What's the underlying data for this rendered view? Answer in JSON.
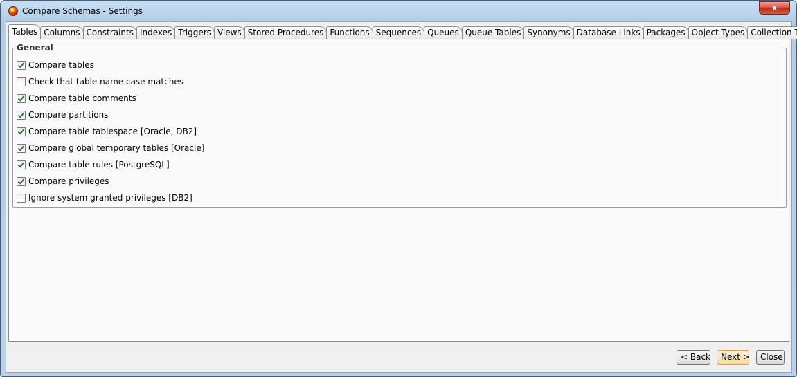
{
  "window": {
    "title": "Compare Schemas - Settings",
    "close_glyph": "x"
  },
  "tabs": [
    {
      "label": "Tables",
      "active": true
    },
    {
      "label": "Columns"
    },
    {
      "label": "Constraints"
    },
    {
      "label": "Indexes"
    },
    {
      "label": "Triggers"
    },
    {
      "label": "Views"
    },
    {
      "label": "Stored Procedures"
    },
    {
      "label": "Functions"
    },
    {
      "label": "Sequences"
    },
    {
      "label": "Queues"
    },
    {
      "label": "Queue Tables"
    },
    {
      "label": "Synonyms"
    },
    {
      "label": "Database Links"
    },
    {
      "label": "Packages"
    },
    {
      "label": "Object Types"
    },
    {
      "label": "Collection Types"
    }
  ],
  "general": {
    "legend": "General",
    "options": [
      {
        "label": "Compare tables",
        "checked": true
      },
      {
        "label": "Check that table name case matches",
        "checked": false
      },
      {
        "label": "Compare table comments",
        "checked": true
      },
      {
        "label": "Compare partitions",
        "checked": true
      },
      {
        "label": "Compare table tablespace [Oracle, DB2]",
        "checked": true
      },
      {
        "label": "Compare global temporary tables [Oracle]",
        "checked": true
      },
      {
        "label": "Compare table rules [PostgreSQL]",
        "checked": true
      },
      {
        "label": "Compare privileges",
        "checked": true
      },
      {
        "label": "Ignore system granted privileges [DB2]",
        "checked": false
      }
    ]
  },
  "buttons": {
    "back": "< Back",
    "next": "Next >",
    "close": "Close"
  },
  "colors": {
    "check": "#2d7a2d",
    "title_close": "#c9341d",
    "default_button": "#d8a040"
  }
}
